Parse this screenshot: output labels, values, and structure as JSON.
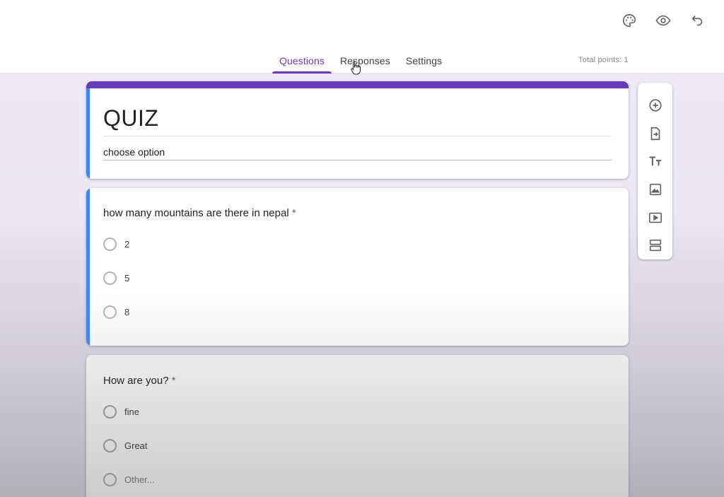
{
  "header": {
    "tabs": [
      {
        "label": "Questions",
        "active": true
      },
      {
        "label": "Responses",
        "active": false
      },
      {
        "label": "Settings",
        "active": false
      }
    ],
    "total_points": "Total points: 1",
    "top_icons": [
      "palette-icon",
      "eye-icon",
      "undo-icon"
    ]
  },
  "form": {
    "title": "QUIZ",
    "description": "choose option"
  },
  "questions": [
    {
      "text": "how many mountains are there in nepal",
      "required_mark": "*",
      "options": [
        "2",
        "5",
        "8"
      ]
    },
    {
      "text": "How are you?",
      "required_mark": "*",
      "options": [
        "fine",
        "Great",
        "Other..."
      ]
    }
  ],
  "toolbar": {
    "items": [
      "add-question-icon",
      "import-questions-icon",
      "add-title-icon",
      "add-image-icon",
      "add-video-icon",
      "add-section-icon"
    ]
  },
  "colors": {
    "accent": "#673ab7",
    "active_card_bar": "#4285f4",
    "background": "#efeaf6"
  }
}
